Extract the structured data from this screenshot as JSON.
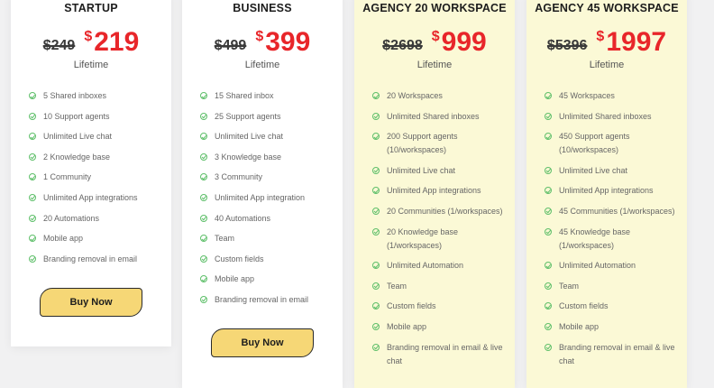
{
  "plans": [
    {
      "name": "STARTUP",
      "old_price": "$249",
      "currency": "$",
      "price": "219",
      "period": "Lifetime",
      "features": [
        "5 Shared inboxes",
        "10 Support agents",
        "Unlimited Live chat",
        "2 Knowledge base",
        "1 Community",
        "Unlimited App integrations",
        "20 Automations",
        "Mobile app",
        "Branding removal in email"
      ],
      "button_label": "Buy Now"
    },
    {
      "name": "BUSINESS",
      "old_price": "$499",
      "currency": "$",
      "price": "399",
      "period": "Lifetime",
      "features": [
        "15 Shared inbox",
        "25 Support agents",
        "Unlimited Live chat",
        "3 Knowledge base",
        "3 Community",
        "Unlimited App integration",
        "40 Automations",
        "Team",
        "Custom fields",
        "Mobile app",
        "Branding removal in email"
      ],
      "button_label": "Buy Now"
    },
    {
      "name": "AGENCY 20 WORKSPACE",
      "old_price": "$2698",
      "currency": "$",
      "price": "999",
      "period": "Lifetime",
      "features": [
        "20 Workspaces",
        "Unlimited Shared inboxes",
        "200 Support agents (10/workspaces)",
        "Unlimited Live chat",
        "Unlimited App integrations",
        "20 Communities (1/workspaces)",
        "20 Knowledge base (1/workspaces)",
        "Unlimited Automation",
        "Team",
        "Custom fields",
        "Mobile app",
        "Branding removal in email & live chat"
      ]
    },
    {
      "name": "AGENCY 45 WORKSPACE",
      "old_price": "$5396",
      "currency": "$",
      "price": "1997",
      "period": "Lifetime",
      "features": [
        "45 Workspaces",
        "Unlimited Shared inboxes",
        "450 Support agents (10/workspaces)",
        "Unlimited Live chat",
        "Unlimited App integrations",
        "45 Communities (1/workspaces)",
        "45 Knowledge base (1/workspaces)",
        "Unlimited Automation",
        "Team",
        "Custom fields",
        "Mobile app",
        "Branding removal in email & live chat"
      ]
    }
  ],
  "colors": {
    "page_background": "#f1f1f2",
    "card_background": "#ffffff",
    "agency_card_background": "#fbf9d6",
    "price_red": "#e8262a",
    "check_green": "#5fbf6a",
    "button_yellow": "#f6d776"
  },
  "icons": {
    "feature_bullet": "check-circle-icon"
  }
}
